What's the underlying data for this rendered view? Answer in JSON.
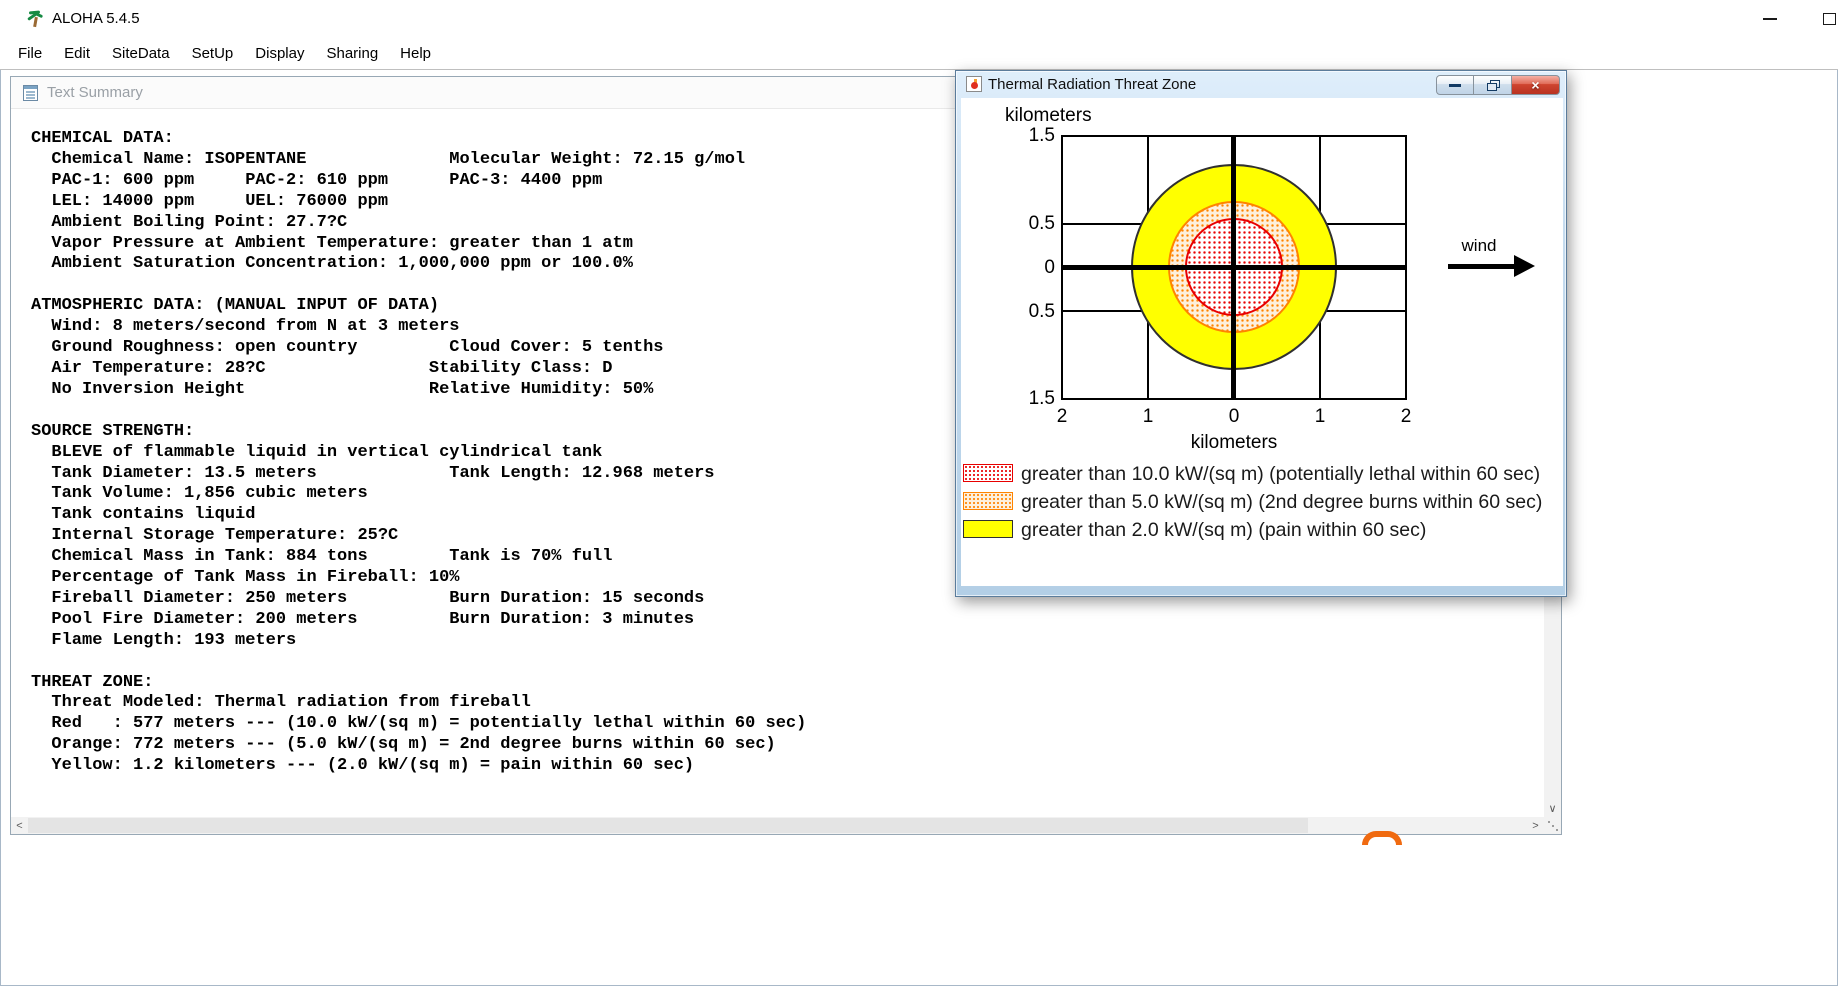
{
  "app": {
    "title": "ALOHA 5.4.5",
    "menu": [
      "File",
      "Edit",
      "SiteData",
      "SetUp",
      "Display",
      "Sharing",
      "Help"
    ]
  },
  "icons": {
    "app_logo": "palm-tree",
    "minimize": "—",
    "maximize": "□",
    "restore": "❐",
    "close": "×",
    "scroll_up": "∧",
    "scroll_down": "∨",
    "scroll_left": "<",
    "scroll_right": ">"
  },
  "text_summary_window": {
    "title": "Text Summary",
    "content": "CHEMICAL DATA:\n  Chemical Name: ISOPENTANE              Molecular Weight: 72.15 g/mol\n  PAC-1: 600 ppm     PAC-2: 610 ppm      PAC-3: 4400 ppm\n  LEL: 14000 ppm     UEL: 76000 ppm\n  Ambient Boiling Point: 27.7?C\n  Vapor Pressure at Ambient Temperature: greater than 1 atm\n  Ambient Saturation Concentration: 1,000,000 ppm or 100.0%\n\nATMOSPHERIC DATA: (MANUAL INPUT OF DATA)\n  Wind: 8 meters/second from N at 3 meters\n  Ground Roughness: open country         Cloud Cover: 5 tenths\n  Air Temperature: 28?C                Stability Class: D\n  No Inversion Height                  Relative Humidity: 50%\n\nSOURCE STRENGTH:\n  BLEVE of flammable liquid in vertical cylindrical tank\n  Tank Diameter: 13.5 meters             Tank Length: 12.968 meters\n  Tank Volume: 1,856 cubic meters\n  Tank contains liquid\n  Internal Storage Temperature: 25?C\n  Chemical Mass in Tank: 884 tons        Tank is 70% full\n  Percentage of Tank Mass in Fireball: 10%\n  Fireball Diameter: 250 meters          Burn Duration: 15 seconds\n  Pool Fire Diameter: 200 meters         Burn Duration: 3 minutes\n  Flame Length: 193 meters\n\nTHREAT ZONE:\n  Threat Modeled: Thermal radiation from fireball\n  Red   : 577 meters --- (10.0 kW/(sq m) = potentially lethal within 60 sec)\n  Orange: 772 meters --- (5.0 kW/(sq m) = 2nd degree burns within 60 sec)\n  Yellow: 1.2 kilometers --- (2.0 kW/(sq m) = pain within 60 sec)"
  },
  "threat_zone_window": {
    "title": "Thermal Radiation Threat Zone",
    "top_axis_label": "kilometers",
    "bottom_axis_label": "kilometers",
    "wind_label": "wind",
    "y_ticks": [
      "1.5",
      "0.5",
      "0",
      "0.5",
      "1.5"
    ],
    "x_ticks": [
      "2",
      "1",
      "0",
      "1",
      "2"
    ],
    "legend": [
      {
        "name": "red",
        "color": "#e80000",
        "fill_style": "red dot stipple",
        "label": "greater than 10.0 kW/(sq m) (potentially lethal within 60 sec)"
      },
      {
        "name": "orange",
        "color": "#ff8400",
        "fill_style": "orange dot stipple",
        "label": "greater than 5.0 kW/(sq m) (2nd degree burns within 60 sec)"
      },
      {
        "name": "yellow",
        "color": "#ffff00",
        "fill_style": "solid",
        "label": "greater than 2.0 kW/(sq m) (pain within 60 sec)"
      }
    ]
  },
  "chart_data": {
    "type": "area",
    "title": "Thermal Radiation Threat Zone",
    "xlabel": "kilometers",
    "ylabel": "kilometers",
    "xlim": [
      -2,
      2
    ],
    "ylim": [
      -1.5,
      1.5
    ],
    "x_tick_values": [
      -2,
      -1,
      0,
      1,
      2
    ],
    "y_tick_values": [
      -1.5,
      -0.5,
      0,
      0.5,
      1.5
    ],
    "grid": true,
    "wind": {
      "label": "wind",
      "arrow_direction": "pointing right (+x)"
    },
    "zones": [
      {
        "name": "red",
        "threshold_kw_per_sq_m": 10.0,
        "radius_km": 0.577,
        "center": [
          0,
          0
        ],
        "effect": "potentially lethal within 60 sec",
        "color": "#e80000"
      },
      {
        "name": "orange",
        "threshold_kw_per_sq_m": 5.0,
        "radius_km": 0.772,
        "center": [
          0,
          0
        ],
        "effect": "2nd degree burns within 60 sec",
        "color": "#ff8400"
      },
      {
        "name": "yellow",
        "threshold_kw_per_sq_m": 2.0,
        "radius_km": 1.2,
        "center": [
          0,
          0
        ],
        "effect": "pain within 60 sec",
        "color": "#ffff00"
      }
    ]
  }
}
